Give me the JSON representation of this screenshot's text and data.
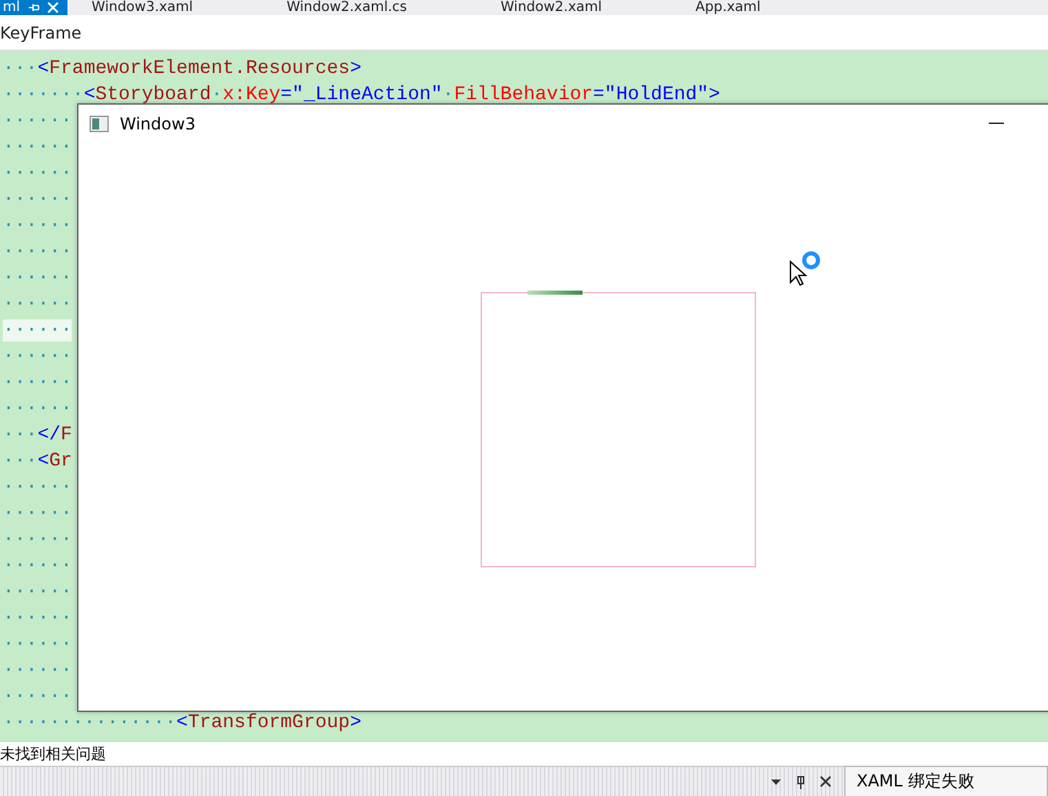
{
  "doc_tabs": [
    {
      "label": "ml",
      "selected": true
    },
    {
      "label": "Window3.xaml",
      "selected": false
    },
    {
      "label": "Window2.xaml.cs",
      "selected": false
    },
    {
      "label": "Window2.xaml",
      "selected": false
    },
    {
      "label": "App.xaml",
      "selected": false
    }
  ],
  "breadcrumb": "KeyFrame",
  "code_lines": [
    {
      "current": false,
      "segments": [
        {
          "kind": "ws",
          "text": "···"
        },
        {
          "kind": "punct",
          "text": "<"
        },
        {
          "kind": "tag",
          "text": "FrameworkElement.Resources"
        },
        {
          "kind": "punct",
          "text": ">"
        }
      ]
    },
    {
      "current": false,
      "segments": [
        {
          "kind": "ws",
          "text": "·······"
        },
        {
          "kind": "punct",
          "text": "<"
        },
        {
          "kind": "tag",
          "text": "Storyboard"
        },
        {
          "kind": "ws",
          "text": "·"
        },
        {
          "kind": "attr",
          "text": "x:Key"
        },
        {
          "kind": "punct",
          "text": "=\""
        },
        {
          "kind": "value",
          "text": "_LineAction"
        },
        {
          "kind": "punct",
          "text": "\""
        },
        {
          "kind": "ws",
          "text": "·"
        },
        {
          "kind": "attr",
          "text": "FillBehavior"
        },
        {
          "kind": "punct",
          "text": "=\""
        },
        {
          "kind": "value",
          "text": "HoldEnd"
        },
        {
          "kind": "punct",
          "text": "\">"
        }
      ]
    },
    {
      "current": false,
      "segments": [
        {
          "kind": "ws",
          "text": "······"
        }
      ]
    },
    {
      "current": false,
      "segments": [
        {
          "kind": "ws",
          "text": "······"
        }
      ]
    },
    {
      "current": false,
      "segments": [
        {
          "kind": "ws",
          "text": "······"
        }
      ]
    },
    {
      "current": false,
      "segments": [
        {
          "kind": "ws",
          "text": "······"
        }
      ]
    },
    {
      "current": false,
      "segments": [
        {
          "kind": "ws",
          "text": "······"
        }
      ]
    },
    {
      "current": false,
      "segments": [
        {
          "kind": "ws",
          "text": "······"
        }
      ]
    },
    {
      "current": false,
      "segments": [
        {
          "kind": "ws",
          "text": "······"
        }
      ]
    },
    {
      "current": false,
      "segments": [
        {
          "kind": "ws",
          "text": "······"
        }
      ]
    },
    {
      "current": true,
      "segments": [
        {
          "kind": "ws",
          "text": "······"
        }
      ]
    },
    {
      "current": false,
      "segments": [
        {
          "kind": "ws",
          "text": "······"
        }
      ]
    },
    {
      "current": false,
      "segments": [
        {
          "kind": "ws",
          "text": "······"
        }
      ]
    },
    {
      "current": false,
      "segments": [
        {
          "kind": "ws",
          "text": "······"
        }
      ]
    },
    {
      "current": false,
      "segments": [
        {
          "kind": "ws",
          "text": "···"
        },
        {
          "kind": "punct",
          "text": "</"
        },
        {
          "kind": "tag",
          "text": "F"
        }
      ]
    },
    {
      "current": false,
      "segments": [
        {
          "kind": "ws",
          "text": "···"
        },
        {
          "kind": "punct",
          "text": "<"
        },
        {
          "kind": "tag",
          "text": "Gr"
        }
      ]
    },
    {
      "current": false,
      "segments": [
        {
          "kind": "ws",
          "text": "······"
        }
      ]
    },
    {
      "current": false,
      "segments": [
        {
          "kind": "ws",
          "text": "······"
        }
      ]
    },
    {
      "current": false,
      "segments": [
        {
          "kind": "ws",
          "text": "······"
        }
      ]
    },
    {
      "current": false,
      "segments": [
        {
          "kind": "ws",
          "text": "······"
        }
      ]
    },
    {
      "current": false,
      "segments": [
        {
          "kind": "ws",
          "text": "······"
        }
      ]
    },
    {
      "current": false,
      "segments": [
        {
          "kind": "ws",
          "text": "······"
        }
      ]
    },
    {
      "current": false,
      "segments": [
        {
          "kind": "ws",
          "text": "······"
        }
      ]
    },
    {
      "current": false,
      "segments": [
        {
          "kind": "ws",
          "text": "······"
        }
      ]
    },
    {
      "current": false,
      "segments": [
        {
          "kind": "ws",
          "text": "······"
        }
      ]
    },
    {
      "current": false,
      "segments": [
        {
          "kind": "ws",
          "text": "···············"
        },
        {
          "kind": "punct",
          "text": "<"
        },
        {
          "kind": "tag",
          "text": "TransformGroup"
        },
        {
          "kind": "punct",
          "text": ">"
        }
      ]
    }
  ],
  "window": {
    "title": "Window3"
  },
  "status_text": "未找到相关问题",
  "panel_tab": "XAML 绑定失败"
}
